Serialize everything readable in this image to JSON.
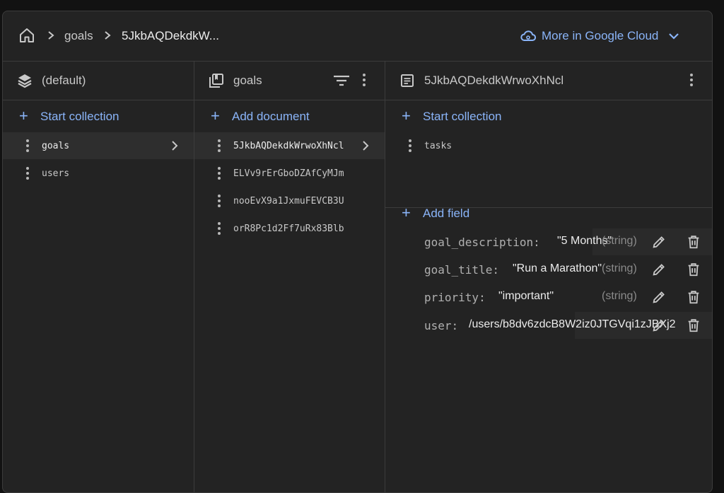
{
  "breadcrumb": {
    "items": [
      "goals",
      "5JkbAQDekdkW..."
    ]
  },
  "cloud_link": {
    "label": "More in Google Cloud"
  },
  "col_root": {
    "title": "(default)",
    "add_label": "Start collection",
    "items": [
      "goals",
      "users"
    ]
  },
  "col_collection": {
    "title": "goals",
    "add_label": "Add document",
    "items": [
      "5JkbAQDekdkWrwoXhNcl",
      "ELVv9rErGboDZAfCyMJm",
      "nooEvX9a1JxmuFEVCB3U",
      "orR8Pc1d2Ff7uRx83Blb"
    ]
  },
  "col_document": {
    "title": "5JkbAQDekdkWrwoXhNcl",
    "add_collection_label": "Start collection",
    "subcollections": [
      "tasks"
    ],
    "add_field_label": "Add field",
    "fields": [
      {
        "name": "goal_description:",
        "value": "\"5 Months\"",
        "type": "(string)"
      },
      {
        "name": "goal_title:",
        "value": "\"Run a Marathon\"",
        "type": "(string)"
      },
      {
        "name": "priority:",
        "value": "\"important\"",
        "type": "(string)"
      },
      {
        "name": "user:",
        "value": "/users/b8dv6zdcB8W2iz0JTGVqi1zJBXj2",
        "type": ""
      }
    ]
  },
  "colors": {
    "accent": "#8ab4f8",
    "background": "#232323",
    "border": "#3c3c3c"
  }
}
